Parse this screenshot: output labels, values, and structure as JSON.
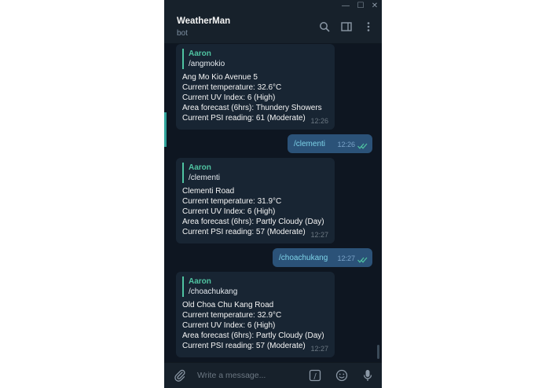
{
  "window": {
    "minimize": "—",
    "maximize": "☐",
    "close": "✕"
  },
  "header": {
    "title": "WeatherMan",
    "subtitle": "bot"
  },
  "messages": [
    {
      "type": "incoming",
      "reply_author": "Aaron",
      "reply_text": "/angmokio",
      "lines": [
        "Ang Mo Kio Avenue 5",
        "Current temperature: 32.6°C",
        "Current UV Index: 6 (High)",
        "Area forecast (6hrs): Thundery Showers",
        "Current PSI reading: 61 (Moderate)"
      ],
      "time": "12:26"
    },
    {
      "type": "outgoing",
      "text": "/clementi",
      "time": "12:26"
    },
    {
      "type": "incoming",
      "reply_author": "Aaron",
      "reply_text": "/clementi",
      "lines": [
        "Clementi Road",
        "Current temperature: 31.9°C",
        "Current UV Index: 6 (High)",
        "Area forecast (6hrs): Partly Cloudy (Day)",
        "Current PSI reading: 57 (Moderate)"
      ],
      "time": "12:27"
    },
    {
      "type": "outgoing",
      "text": "/choachukang",
      "time": "12:27"
    },
    {
      "type": "incoming",
      "reply_author": "Aaron",
      "reply_text": "/choachukang",
      "lines": [
        "Old Choa Chu Kang Road",
        "Current temperature: 32.9°C",
        "Current UV Index: 6 (High)",
        "Area forecast (6hrs): Partly Cloudy (Day)",
        "Current PSI reading: 57 (Moderate)"
      ],
      "time": "12:27"
    }
  ],
  "composer": {
    "placeholder": "Write a message...",
    "commands_glyph": "/"
  },
  "colors": {
    "accent": "#4fc3a1",
    "background": "#0e1621",
    "bubble_in": "#182533",
    "bubble_out": "#2b5278"
  }
}
